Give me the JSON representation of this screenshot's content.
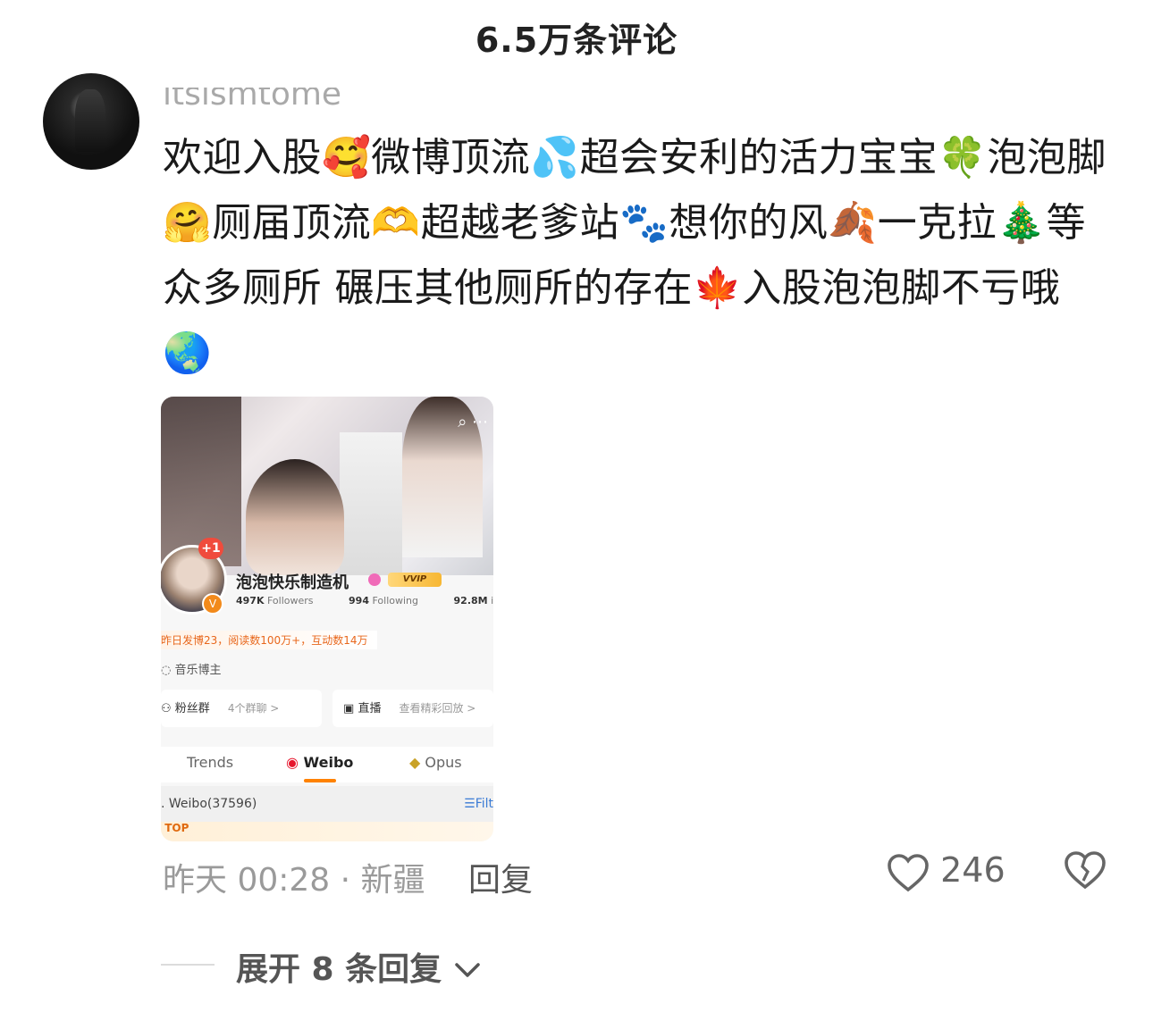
{
  "header": {
    "title": "6.5万条评论"
  },
  "comment": {
    "username": "itsismtome",
    "text_segments": [
      "欢迎入股",
      "🥰",
      "微博顶流",
      "💦",
      "超会安利的活力宝宝",
      "🍀",
      "泡泡脚",
      "🤗",
      "厕届顶流",
      "🫶",
      "超越老爹站",
      "🐾",
      "想你的风",
      "🍂",
      "一克拉",
      "🎄",
      "等众多厕所 碾压其他厕所的存在",
      "🍁",
      "入股泡泡脚不亏哦",
      "🌏"
    ],
    "meta": "昨天 00:28 · 新疆",
    "reply_label": "回复",
    "like_count": "246",
    "expand_label": "展开 8 条回复"
  },
  "card": {
    "plus_badge": "+1",
    "name": "泡泡快乐制造机",
    "vvip": "VVIP",
    "followers_num": "497K",
    "followers_label": "Followers",
    "following_num": "994",
    "following_label": "Following",
    "interactions_num": "92.8M",
    "interactions_label": "interactio",
    "hot_line": "昨日发博23，阅读数100万+，互动数14万",
    "tag": "音乐博主",
    "fans_group_label": "粉丝群",
    "fans_group_sub": "4个群聊 >",
    "live_label": "直播",
    "live_sub": "查看精彩回放 >",
    "tabs": [
      "Trends",
      "Weibo",
      "Opus"
    ],
    "weibo_count": ". Weibo(37596)",
    "filter_label": "Filt",
    "top_label": "TOP"
  },
  "colors": {
    "accent": "#ff8200",
    "meta_gray": "#9a9a9a"
  }
}
